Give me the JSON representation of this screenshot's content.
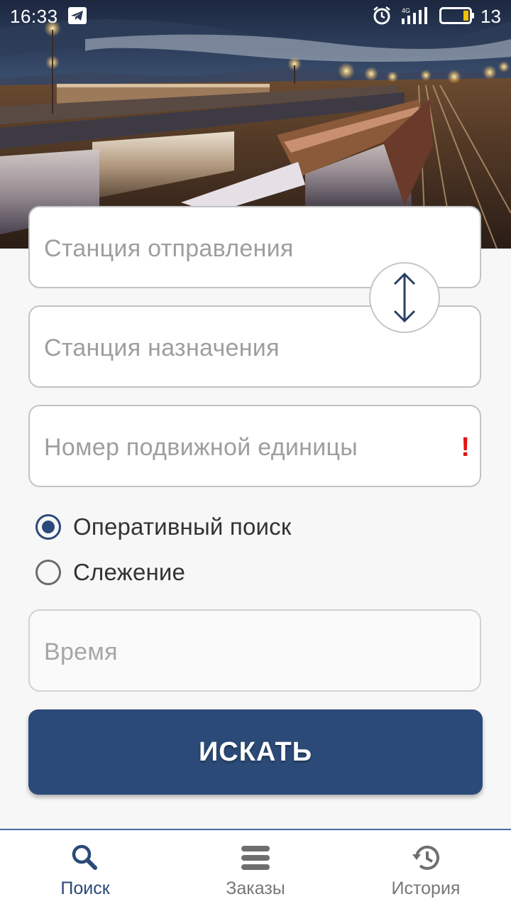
{
  "status_bar": {
    "time": "16:33",
    "battery_level": "13",
    "network_label": "4G"
  },
  "form": {
    "departure_placeholder": "Станция отправления",
    "destination_placeholder": "Станция назначения",
    "unit_number_placeholder": "Номер подвижной единицы",
    "unit_number_alert": "!",
    "time_placeholder": "Время"
  },
  "search_mode": {
    "options": [
      {
        "label": "Оперативный поиск",
        "checked": true
      },
      {
        "label": "Слежение",
        "checked": false
      }
    ]
  },
  "search_button_label": "ИСКАТЬ",
  "bottom_nav": {
    "items": [
      {
        "label": "Поиск",
        "icon": "search-icon",
        "active": true
      },
      {
        "label": "Заказы",
        "icon": "list-icon",
        "active": false
      },
      {
        "label": "История",
        "icon": "history-icon",
        "active": false
      }
    ]
  },
  "colors": {
    "primary": "#2b4a78",
    "alert": "#e01414",
    "background": "#f7f7f7"
  }
}
